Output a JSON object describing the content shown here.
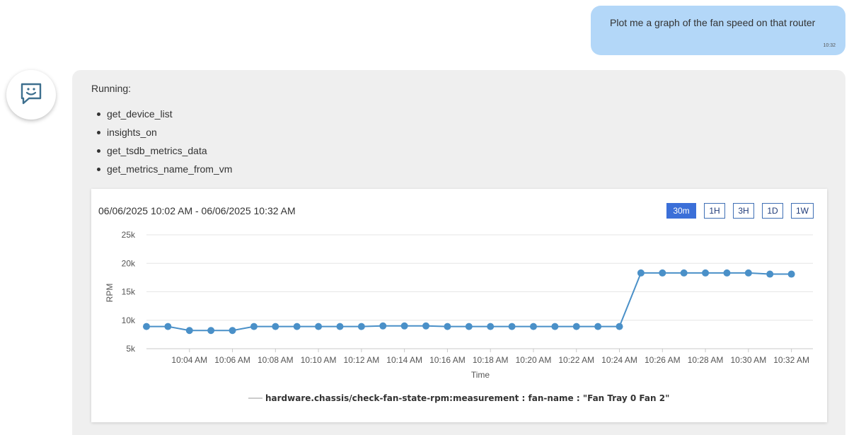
{
  "user_message": {
    "text": "Plot me a graph of the fan speed on that router",
    "time": "10:32"
  },
  "assistant": {
    "avatar_icon": "chat-bot-icon",
    "running_label": "Running:",
    "tools": [
      "get_device_list",
      "insights_on",
      "get_tsdb_metrics_data",
      "get_metrics_name_from_vm"
    ]
  },
  "chart": {
    "date_range": "06/06/2025 10:02 AM - 06/06/2025 10:32 AM",
    "range_buttons": [
      {
        "label": "30m",
        "active": true
      },
      {
        "label": "1H",
        "active": false
      },
      {
        "label": "3H",
        "active": false
      },
      {
        "label": "1D",
        "active": false
      },
      {
        "label": "1W",
        "active": false
      }
    ],
    "accent_color": "#3b6fd8",
    "series_color": "#4a90c8"
  },
  "chart_data": {
    "type": "line",
    "xlabel": "Time",
    "ylabel": "RPM",
    "ylim": [
      5000,
      25000
    ],
    "y_ticks": [
      {
        "value": 5000,
        "label": "5k"
      },
      {
        "value": 10000,
        "label": "10k"
      },
      {
        "value": 15000,
        "label": "15k"
      },
      {
        "value": 20000,
        "label": "20k"
      },
      {
        "value": 25000,
        "label": "25k"
      }
    ],
    "x_start": "10:02",
    "x_end": "10:33",
    "x_ticks": [
      "10:04 AM",
      "10:06 AM",
      "10:08 AM",
      "10:10 AM",
      "10:12 AM",
      "10:14 AM",
      "10:16 AM",
      "10:18 AM",
      "10:20 AM",
      "10:22 AM",
      "10:24 AM",
      "10:26 AM",
      "10:28 AM",
      "10:30 AM",
      "10:32 AM"
    ],
    "grid": true,
    "legend_position": "bottom",
    "series": [
      {
        "name": "hardware.chassis/check-fan-state-rpm:measurement : fan-name : \"Fan Tray 0 Fan 2\"",
        "x": [
          "10:02",
          "10:03",
          "10:04",
          "10:05",
          "10:06",
          "10:07",
          "10:08",
          "10:09",
          "10:10",
          "10:11",
          "10:12",
          "10:13",
          "10:14",
          "10:15",
          "10:16",
          "10:17",
          "10:18",
          "10:19",
          "10:20",
          "10:21",
          "10:22",
          "10:23",
          "10:24",
          "10:25",
          "10:26",
          "10:27",
          "10:28",
          "10:29",
          "10:30",
          "10:31",
          "10:32"
        ],
        "values": [
          8900,
          8900,
          8200,
          8200,
          8200,
          8900,
          8900,
          8900,
          8900,
          8900,
          8900,
          9000,
          9000,
          9000,
          8900,
          8900,
          8900,
          8900,
          8900,
          8900,
          8900,
          8900,
          8900,
          18300,
          18300,
          18300,
          18300,
          18300,
          18300,
          18100,
          18100
        ]
      }
    ]
  }
}
